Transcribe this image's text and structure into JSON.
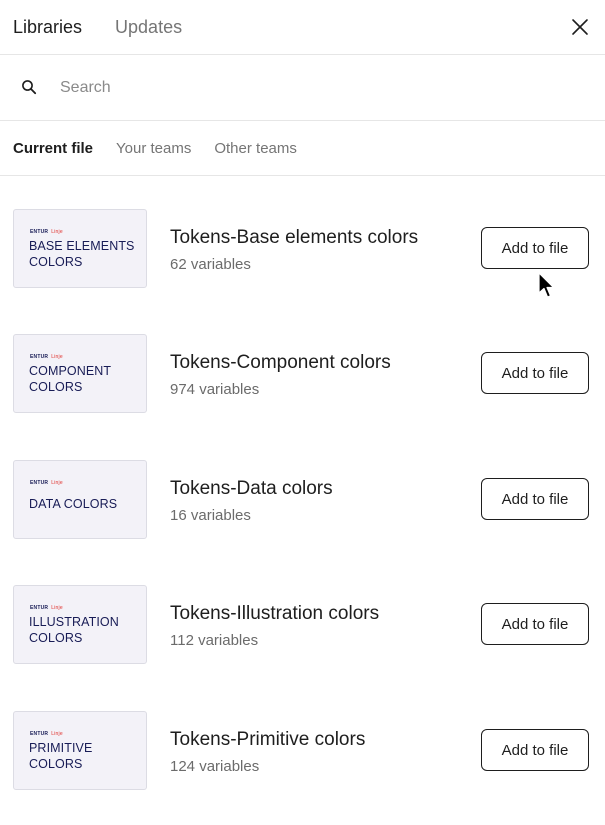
{
  "header": {
    "tabs": [
      {
        "label": "Libraries",
        "active": true
      },
      {
        "label": "Updates",
        "active": false
      }
    ],
    "close_icon": "close-icon"
  },
  "search": {
    "placeholder": "Search",
    "value": "",
    "icon": "search-icon"
  },
  "subtabs": [
    {
      "label": "Current file",
      "active": true
    },
    {
      "label": "Your teams",
      "active": false
    },
    {
      "label": "Other teams",
      "active": false
    }
  ],
  "libraries": [
    {
      "thumb_brand": "ENTUR",
      "thumb_brand_sub": "Linje",
      "thumb_title": "BASE ELEMENTS\nCOLORS",
      "name": "Tokens-Base elements colors",
      "count": "62 variables",
      "button": "Add to file"
    },
    {
      "thumb_brand": "ENTUR",
      "thumb_brand_sub": "Linje",
      "thumb_title": "COMPONENT\nCOLORS",
      "name": "Tokens-Component colors",
      "count": "974 variables",
      "button": "Add to file"
    },
    {
      "thumb_brand": "ENTUR",
      "thumb_brand_sub": "Linje",
      "thumb_title": "DATA COLORS",
      "name": "Tokens-Data colors",
      "count": "16 variables",
      "button": "Add to file"
    },
    {
      "thumb_brand": "ENTUR",
      "thumb_brand_sub": "Linje",
      "thumb_title": "ILLUSTRATION\nCOLORS",
      "name": "Tokens-Illustration colors",
      "count": "112 variables",
      "button": "Add to file"
    },
    {
      "thumb_brand": "ENTUR",
      "thumb_brand_sub": "Linje",
      "thumb_title": "PRIMITIVE\nCOLORS",
      "name": "Tokens-Primitive colors",
      "count": "124 variables",
      "button": "Add to file"
    }
  ],
  "colors": {
    "brand_navy": "#181c56",
    "brand_red": "#e0312c",
    "thumb_bg": "#f3f2f8"
  }
}
